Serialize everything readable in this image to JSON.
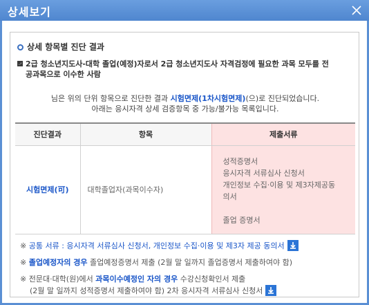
{
  "dialog": {
    "title": "상세보기",
    "close_icon": "close-icon"
  },
  "section": {
    "title": "상세 항목별 진단 결과",
    "subtitle_line1": "2급 청소년지도사-대학 졸업(예정)자로서 2급 청소년지도사 자격검정에 필요한 과목 모두를 전",
    "subtitle_line2": "공과목으로 이수한 사람"
  },
  "result": {
    "line1_prefix": "님은 위의 단위 항목으로 진단한 결과 ",
    "line1_highlight": "시험면제(1차시험면제)",
    "line1_suffix": "(으)로 진단되었습니다.",
    "line2": "아래는 응시자격 상세 검증항목 중 가능/불가능 목록입니다."
  },
  "table": {
    "headers": [
      "진단결과",
      "항목",
      "제출서류"
    ],
    "row": {
      "result": "시험면제(可)",
      "item": "대학졸업자(과목이수자)",
      "docs": [
        "성적증명서",
        "응시자격 서류심사 신청서",
        "개인정보 수집·이용 및 제3자제공동",
        "의서",
        "",
        "졸업 증명서"
      ]
    }
  },
  "notes": {
    "n1_prefix": "※ ",
    "n1_text": "공통 서류 : 응시자격 서류심사 신청서, 개인정보 수집·이용 및 제3자 제공 동의서",
    "n2_prefix": "※ ",
    "n2_bold": "졸업예정자의 경우",
    "n2_text": " 졸업예정증명서 제출 (2월 말 일까지 졸업증명서 제출하여야 함)",
    "n3_prefix": "※ 전문대·대학(원)에서 ",
    "n3_bold": "과목이수예정인 자의 경우",
    "n3_text": " 수강신청확인서 제출",
    "n3_line2": "(2월 말 일까지 성적증명서 제출하여야 함) 2차 응시자격 서류심사 신청서"
  },
  "colors": {
    "titlebar": "#5a8fd4",
    "accent": "#1a56c8",
    "highlight_column": "#fde2e2"
  }
}
